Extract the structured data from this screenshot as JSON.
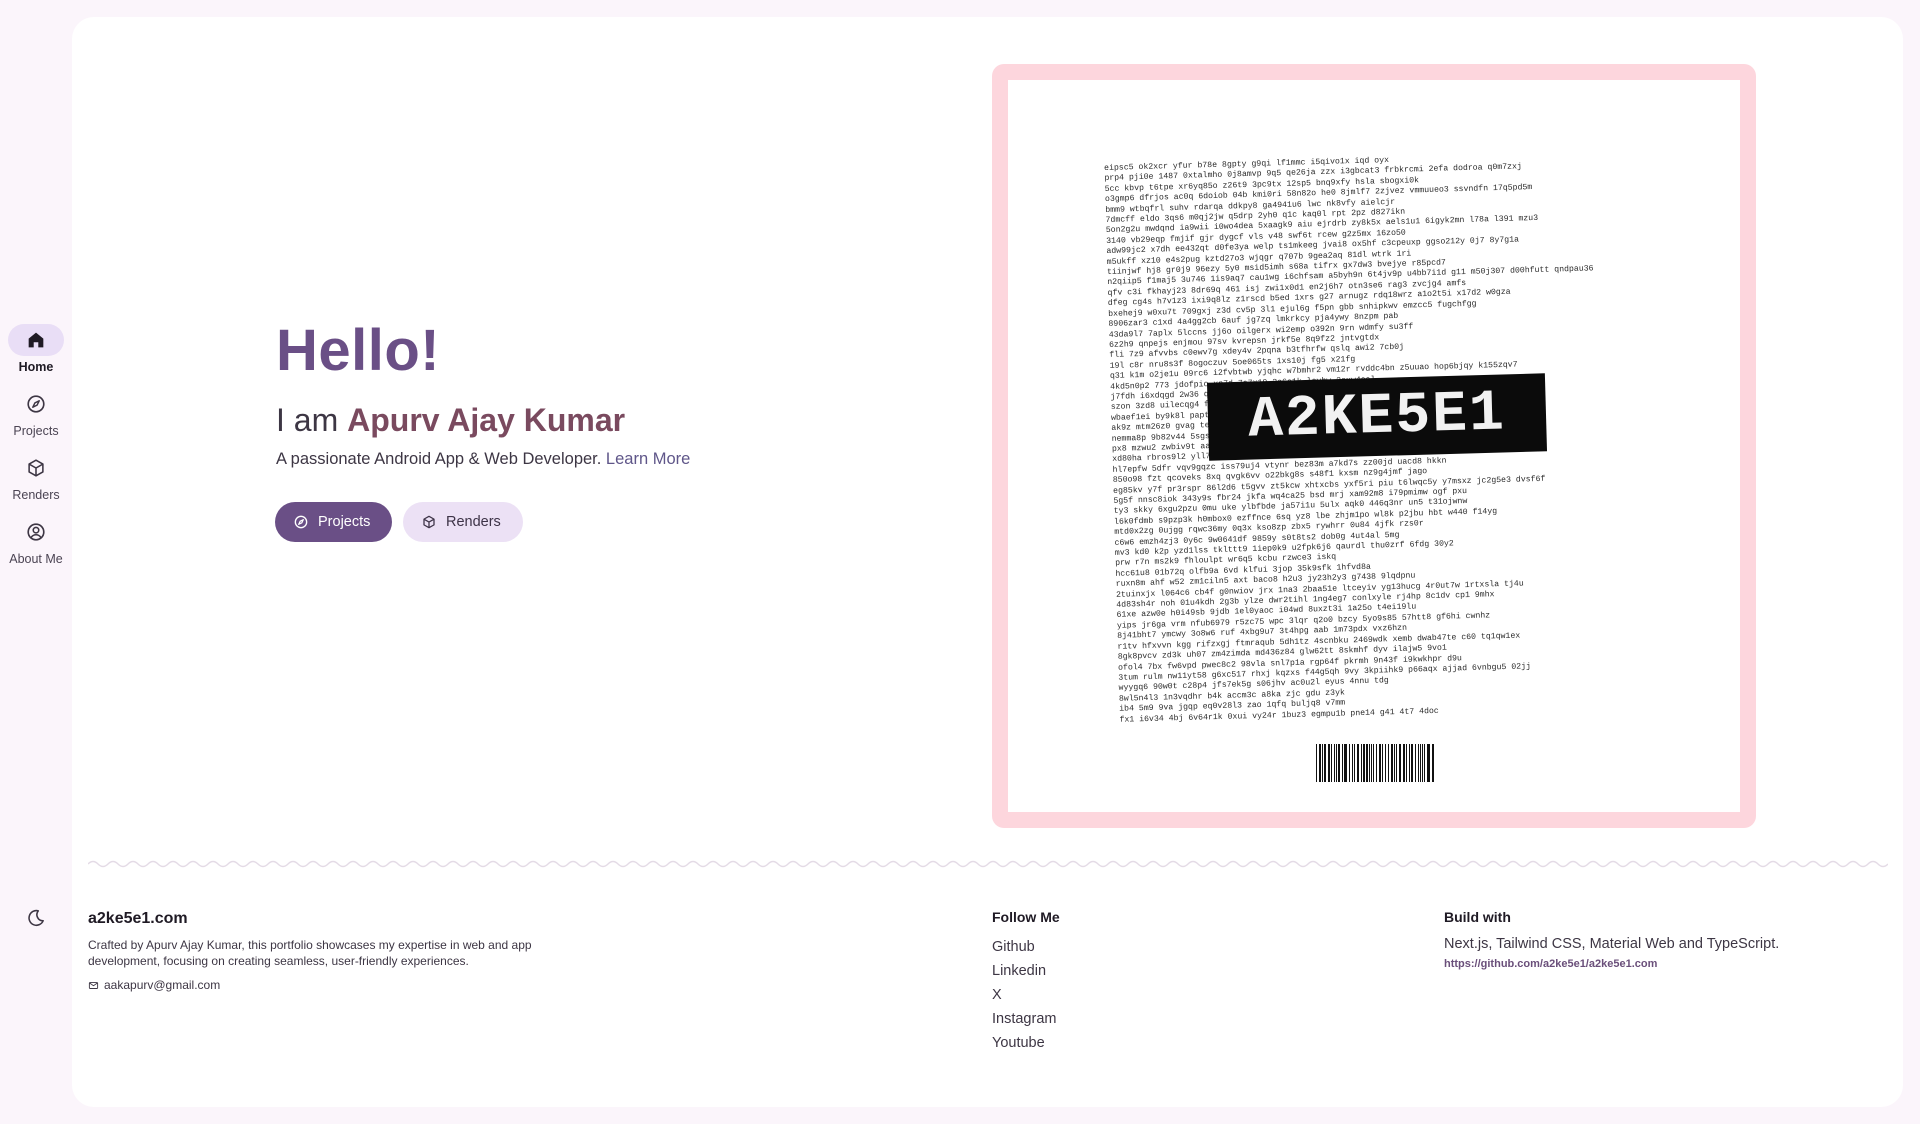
{
  "nav": {
    "items": [
      {
        "label": "Home",
        "icon": "home-icon",
        "active": true
      },
      {
        "label": "Projects",
        "icon": "compass-icon",
        "active": false
      },
      {
        "label": "Renders",
        "icon": "cube-icon",
        "active": false
      },
      {
        "label": "About Me",
        "icon": "account-circle-icon",
        "active": false
      }
    ],
    "theme_toggle_icon": "moon-icon"
  },
  "hero": {
    "greeting": "Hello!",
    "intro_prefix": "I am ",
    "name": "Apurv Ajay Kumar",
    "tagline": "A passionate Android App & Web Developer. ",
    "learn_more": "Learn More",
    "buttons": {
      "projects": "Projects",
      "renders": "Renders"
    },
    "image_stamp_text": "A2KE5E1"
  },
  "footer": {
    "site_name": "a2ke5e1.com",
    "about": "Crafted by Apurv Ajay Kumar, this portfolio showcases my expertise in web and app development, focusing on creating seamless, user-friendly experiences.",
    "email": "aakapurv@gmail.com",
    "follow": {
      "title": "Follow Me",
      "links": [
        "Github",
        "Linkedin",
        "X",
        "Instagram",
        "Youtube"
      ]
    },
    "build": {
      "title": "Build with",
      "text": "Next.js, Tailwind CSS, Material Web and TypeScript.",
      "repo_link": "https://github.com/a2ke5e1/a2ke5e1.com"
    }
  },
  "colors": {
    "accent": "#6a4f86",
    "name_color": "#7a4a5f",
    "frame": "#fdd6dd",
    "background": "#fbf5fb"
  }
}
